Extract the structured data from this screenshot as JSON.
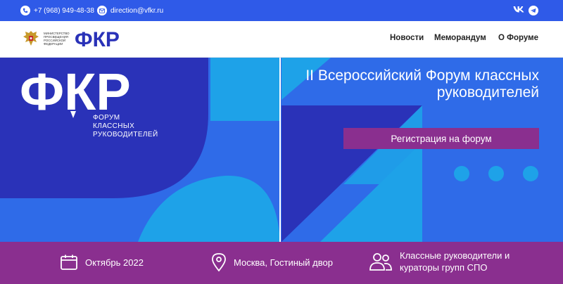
{
  "topbar": {
    "phone": "+7 (968) 949-48-38",
    "email": "direction@vfkr.ru",
    "icons": [
      "phone-icon",
      "mail-icon",
      "vk-icon",
      "telegram-icon"
    ]
  },
  "header": {
    "ministry_text": "Министерство просвещения Российской Федерации",
    "logo_text": "ФКР",
    "nav": [
      {
        "label": "Новости"
      },
      {
        "label": "Меморандум"
      },
      {
        "label": "О Форуме"
      }
    ]
  },
  "hero": {
    "logo_text": "ФКР",
    "subtitle": [
      "Форум",
      "классных",
      "руководителей"
    ],
    "title": "II Всероссийский Форум классных руководителей",
    "register_label": "Регистрация на форум",
    "slide_dots": 3
  },
  "info": {
    "date": "Октябрь 2022",
    "place": "Москва, Гостиный двор",
    "audience": "Классные руководители и кураторы групп СПО"
  },
  "colors": {
    "primary_blue": "#2f5ae8",
    "hero_blue": "#2f6be8",
    "dark_blue": "#2a32b8",
    "light_blue": "#1ea2e8",
    "purple": "#8a2f8f"
  }
}
